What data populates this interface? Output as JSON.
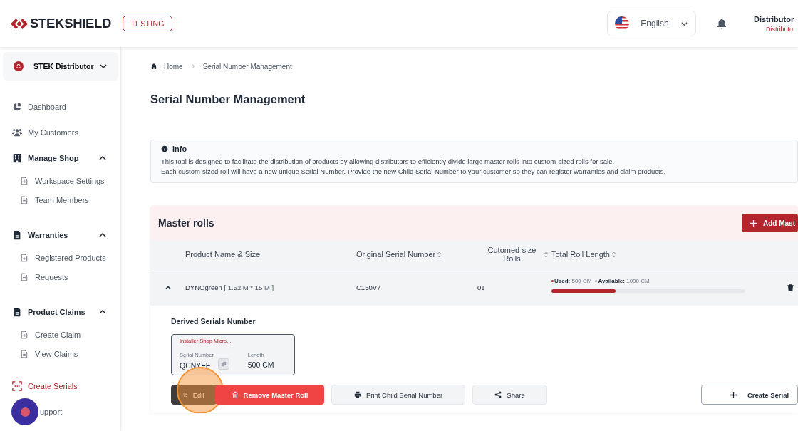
{
  "header": {
    "logo": "STEKSHIELD",
    "env_badge": "TESTING",
    "language": "English",
    "user_name": "Distributor",
    "user_role": "Distributo"
  },
  "sidebar": {
    "account": "STEK Distributor",
    "items": [
      {
        "label": "Dashboard",
        "kind": "link",
        "selected": false
      },
      {
        "label": "My Customers",
        "kind": "link",
        "selected": false
      },
      {
        "label": "Manage Shop",
        "kind": "group",
        "expanded": true,
        "children": [
          {
            "label": "Workspace Settings",
            "selected": false
          },
          {
            "label": "Team Members",
            "selected": false
          }
        ]
      },
      {
        "label": "Warranties",
        "kind": "group",
        "expanded": true,
        "children": [
          {
            "label": "Registered Products",
            "selected": false
          },
          {
            "label": "Requests",
            "selected": false
          }
        ]
      },
      {
        "label": "Product Claims",
        "kind": "group",
        "expanded": true,
        "children": [
          {
            "label": "Create Claim",
            "selected": false
          },
          {
            "label": "View Claims",
            "selected": false
          }
        ]
      },
      {
        "label": "Create Serials",
        "kind": "link",
        "selected": true
      },
      {
        "label": "upport",
        "kind": "link",
        "selected": false
      }
    ]
  },
  "breadcrumb": [
    "Home",
    "Serial Number Management"
  ],
  "title": "Serial Number Management",
  "info": {
    "heading": "Info",
    "lines": [
      "This tool is designed to facilitate the distribution of products by allowing distributors to efficiently divide large master rolls into custom-sized rolls for sale.",
      "Each custom-sized roll will have a new unique Serial Number. Provide the new Child Serial Number to your customer so they can register warranties and claim products."
    ]
  },
  "master_rolls": {
    "heading": "Master rolls",
    "add_button": "Add Mast",
    "columns": [
      {
        "label": "Product Name & Size",
        "sortable": false
      },
      {
        "label": "Original Serial Number",
        "sortable": true
      },
      {
        "label": "Cutomed-size Rolls",
        "sortable": true
      },
      {
        "label": "Total Roll Length",
        "sortable": true
      }
    ],
    "rows": [
      {
        "expanded": true,
        "product": "DYNOgreen",
        "size": "[ 1.52 M * 15 M ]",
        "serial": "C150V7",
        "rolls": "01",
        "used_label": "Used:",
        "used": "500 CM",
        "available_label": "Available:",
        "available": "1000 CM",
        "level": 0.33,
        "derived": {
          "heading": "Derived Serials Number",
          "cards": [
            {
              "shop": "Installer Shop Micro...",
              "serial_label": "Serial Number",
              "serial": "QCNYFE",
              "length_label": "Length",
              "length": "500 CM"
            }
          ]
        },
        "actions": [
          {
            "label": "Edit",
            "kind": "edit",
            "highlighted": true
          },
          {
            "label": "Remove Master Roll",
            "kind": "remove",
            "highlighted": false
          },
          {
            "label": "Print Child Serial Number",
            "kind": "print",
            "highlighted": false
          },
          {
            "label": "Share",
            "kind": "share",
            "highlighted": false
          }
        ],
        "create_button": "Create Serial"
      }
    ]
  }
}
